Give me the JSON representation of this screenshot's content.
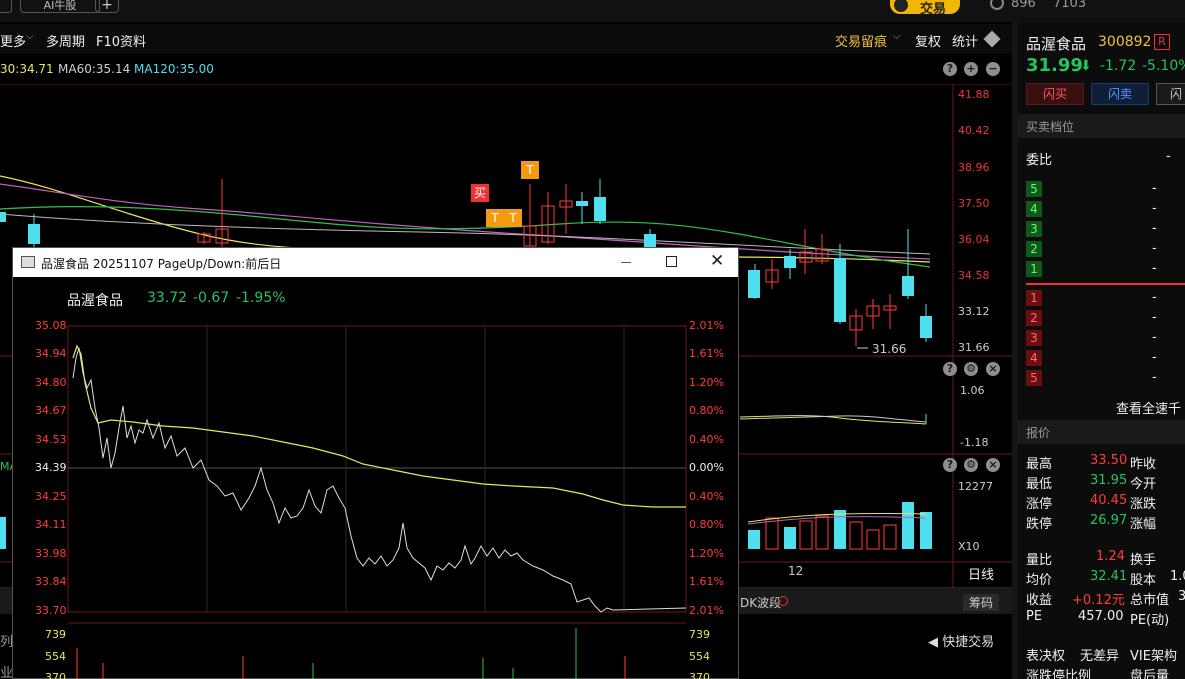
{
  "topbar": {
    "tab1": "",
    "tab2": "AI牛股",
    "add_label": "+",
    "trade_button": "交易",
    "status_count1": "896",
    "status_count2": "7103"
  },
  "toolbar": {
    "more": "更多",
    "multi_period": "多周期",
    "f10": "F10资料",
    "trace": "交易留痕",
    "fuquan": "复权",
    "stats": "统计"
  },
  "ma_line": {
    "ma30": "30:34.71",
    "ma60": "MA60:35.14",
    "ma120": "MA120:35.00"
  },
  "price_axis": [
    "41.88",
    "40.42",
    "38.96",
    "37.50",
    "36.04",
    "34.58",
    "33.12",
    "31.66"
  ],
  "annotations": {
    "buy": "买",
    "t": "T",
    "low_label": "31.66"
  },
  "indicator_axis": {
    "top": "1.06",
    "bottom": "-1.18"
  },
  "volume_axis": {
    "top": "12277",
    "bottom": "X10"
  },
  "bottom_bar": {
    "date_label": "12",
    "day_line": "日线",
    "dk_tab": "DK波段",
    "chip_tab": "筹码",
    "quick_trade": "快捷交易",
    "left_frag1": "列",
    "left_frag2": "业",
    "ma_frag": "MA"
  },
  "popup": {
    "title": "品渥食品 20251107 PageUp/Down:前后日",
    "stock_name": "品渥食品",
    "price": "33.72",
    "change": "-0.67",
    "change_pct": "-1.95%",
    "left_axis": [
      "35.08",
      "34.94",
      "34.80",
      "34.67",
      "34.53",
      "34.39",
      "34.25",
      "34.11",
      "33.98",
      "33.84",
      "33.70"
    ],
    "right_axis": [
      "2.01%",
      "1.61%",
      "1.20%",
      "0.80%",
      "0.40%",
      "0.00%",
      "0.40%",
      "0.80%",
      "1.20%",
      "1.61%",
      "2.01%"
    ],
    "vol_axis": [
      "739",
      "554",
      "370"
    ]
  },
  "right_panel": {
    "name": "品渥食品",
    "code": "300892",
    "tag": "R",
    "price": "31.99",
    "change": "-1.72",
    "change_pct": "-5.10%",
    "flash_buy": "闪买",
    "flash_sell": "闪卖",
    "flash_more": "闪",
    "book_title": "买卖档位",
    "weibi_label": "委比",
    "weibi_value": "-",
    "sell_levels": [
      "5",
      "4",
      "3",
      "2",
      "1"
    ],
    "buy_levels": [
      "1",
      "2",
      "3",
      "4",
      "5"
    ],
    "dash": "-",
    "view_all": "查看全速千",
    "quote_title": "报价",
    "quotes": [
      {
        "k1": "最高",
        "v1": "33.50",
        "k2": "昨收"
      },
      {
        "k1": "最低",
        "v1": "31.95",
        "k2": "今开"
      },
      {
        "k1": "涨停",
        "v1": "40.45",
        "k2": "涨跌"
      },
      {
        "k1": "跌停",
        "v1": "26.97",
        "k2": "涨幅"
      }
    ],
    "stats": [
      {
        "k1": "量比",
        "v1": "1.24",
        "k2": "换手",
        "v2": ""
      },
      {
        "k1": "均价",
        "v1": "32.41",
        "k2": "股本",
        "v2": "1.0"
      },
      {
        "k1": "收益",
        "v1": "+0.12元",
        "k2": "总市值",
        "v2": "3"
      },
      {
        "k1": "PE",
        "v1": "457.00",
        "k2": "PE(动)",
        "v2": ""
      }
    ],
    "biaojue_label": "表决权",
    "biaojue_value": "无差异",
    "vie_label": "VIE架构",
    "zdt_label": "涨跌停比例",
    "hou_label": "盘后量"
  }
}
